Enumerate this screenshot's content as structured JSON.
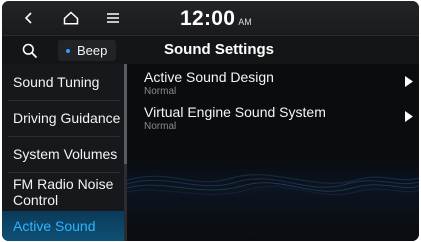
{
  "status_bar": {
    "time": "12:00",
    "ampm": "AM",
    "icons": [
      "back-icon",
      "home-icon",
      "menu-icon"
    ]
  },
  "title_bar": {
    "beep_label": "Beep",
    "title": "Sound Settings",
    "icons": [
      "search-icon"
    ]
  },
  "sidebar": {
    "items": [
      {
        "label": "Sound Tuning"
      },
      {
        "label": "Driving Guidance"
      },
      {
        "label": "System Volumes"
      },
      {
        "label_line1": "FM Radio Noise",
        "label_line2": "Control"
      },
      {
        "label": "Active Sound",
        "active": true
      }
    ]
  },
  "settings": [
    {
      "title": "Active Sound Design",
      "value": "Normal"
    },
    {
      "title": "Virtual Engine Sound System",
      "value": "Normal"
    }
  ],
  "colors": {
    "accent": "#2fb4ff",
    "active_bg": "#0e5074",
    "background": "#0c0c0e"
  }
}
